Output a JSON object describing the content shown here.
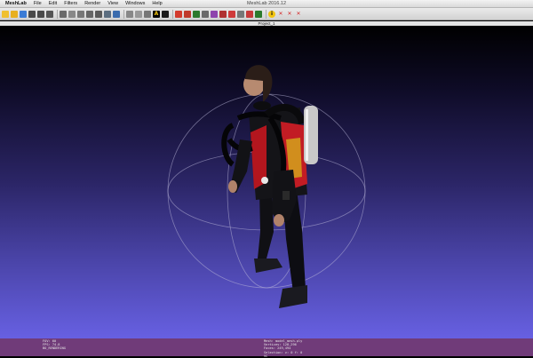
{
  "menubar": {
    "app_name": "MeshLab",
    "items": [
      "File",
      "Edit",
      "Filters",
      "Render",
      "View",
      "Windows",
      "Help"
    ],
    "window_title": "MeshLab 2016.12"
  },
  "tab": {
    "title": "Project_1"
  },
  "toolbar": {
    "buttons": [
      {
        "name": "new-project-icon",
        "color": "#f0c030"
      },
      {
        "name": "open-project-icon",
        "color": "#e8b020"
      },
      {
        "name": "save-project-icon",
        "color": "#3a7bd5"
      },
      {
        "name": "import-mesh-icon",
        "color": "#4a4a4a"
      },
      {
        "name": "export-mesh-icon",
        "color": "#4a4a4a"
      },
      {
        "name": "snapshot-icon",
        "color": "#555555"
      },
      {
        "name": "bounding-box-icon",
        "color": "#6a6a6a"
      },
      {
        "name": "points-icon",
        "color": "#888888"
      },
      {
        "name": "wireframe-icon",
        "color": "#777777"
      },
      {
        "name": "hidden-lines-icon",
        "color": "#666666"
      },
      {
        "name": "flat-lines-icon",
        "color": "#5a5a5a"
      },
      {
        "name": "flat-icon",
        "color": "#5c6e80"
      },
      {
        "name": "smooth-icon",
        "color": "#3b6cae"
      },
      {
        "name": "lighting-icon",
        "color": "#888888"
      },
      {
        "name": "fancy-lighting-icon",
        "color": "#999999"
      },
      {
        "name": "backface-culling-icon",
        "color": "#777777"
      },
      {
        "name": "color-icon",
        "color": "#000000"
      },
      {
        "name": "texture-icon",
        "color": "#1a1a1a"
      },
      {
        "name": "select-faces-icon",
        "color": "#d33a2c"
      },
      {
        "name": "select-vertices-icon",
        "color": "#c0392b"
      },
      {
        "name": "measure-icon",
        "color": "#2c7a2c"
      },
      {
        "name": "align-icon",
        "color": "#6a6a6a"
      },
      {
        "name": "paint-icon",
        "color": "#8e44ad"
      },
      {
        "name": "pick-points-icon",
        "color": "#b03030"
      },
      {
        "name": "z-paint-icon",
        "color": "#cf3a3a"
      },
      {
        "name": "rotate-icon",
        "color": "#777777"
      },
      {
        "name": "quality-icon",
        "color": "#c83a3a"
      },
      {
        "name": "manipulator-icon",
        "color": "#2c7a2c"
      },
      {
        "name": "info-icon",
        "color": "#f1c40f"
      },
      {
        "name": "delete-faces-icon",
        "color": "#d42a2a"
      },
      {
        "name": "delete-vertices-icon",
        "color": "#d42a2a"
      },
      {
        "name": "delete-selection-icon",
        "color": "#d42a2a"
      }
    ],
    "trackball_letter": "A",
    "info_letter": "i"
  },
  "status": {
    "left": [
      "FOV: 60",
      "FPS:   74.8",
      "BO_RENDERING"
    ],
    "center": [
      "Mesh: model_mesh.ply",
      "Vertices: 128,296",
      "Faces: 249,494",
      "Selection: v: 0 f: 0",
      "VC"
    ]
  }
}
